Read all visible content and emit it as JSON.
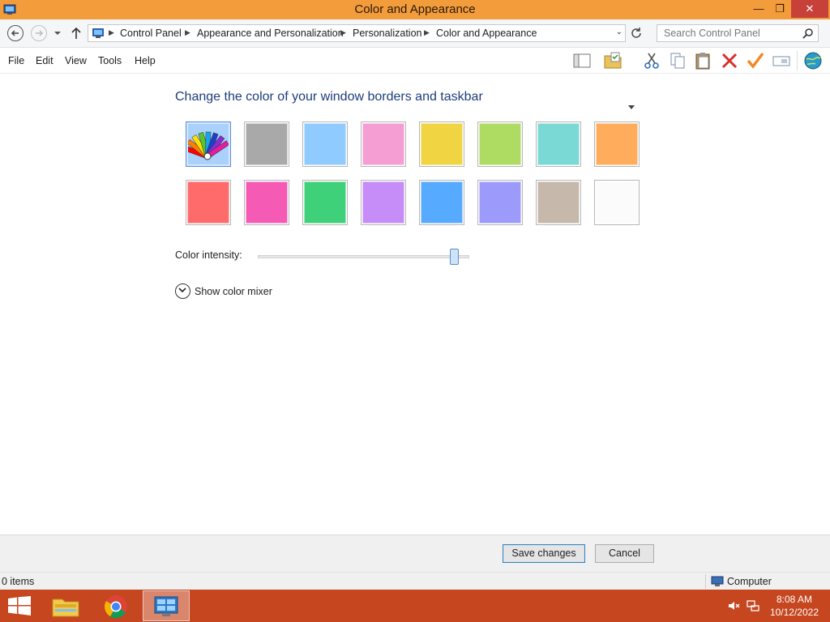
{
  "window": {
    "title": "Color and Appearance",
    "controls": {
      "minimize": "—",
      "restore": "❐",
      "close": "✕"
    }
  },
  "address": {
    "breadcrumbs": [
      "Control Panel",
      "Appearance and Personalization",
      "Personalization",
      "Color and Appearance"
    ],
    "search_placeholder": "Search Control Panel"
  },
  "menu": [
    "File",
    "Edit",
    "View",
    "Tools",
    "Help"
  ],
  "toolbar_icons": [
    "layout-pane-icon",
    "properties-folder-icon",
    "cut-icon",
    "copy-icon",
    "paste-icon",
    "delete-icon",
    "check-icon",
    "rename-icon",
    "globe-icon"
  ],
  "content": {
    "heading": "Change the color of your window borders and taskbar",
    "swatches": [
      {
        "name": "automatic",
        "color": "#8ec5f7",
        "selected": true
      },
      {
        "name": "gray",
        "color": "#a9a9a9"
      },
      {
        "name": "sky-blue",
        "color": "#8fcbff"
      },
      {
        "name": "pink",
        "color": "#f49ed4"
      },
      {
        "name": "yellow",
        "color": "#f1d442"
      },
      {
        "name": "lime",
        "color": "#aedb62"
      },
      {
        "name": "teal",
        "color": "#7ad8d5"
      },
      {
        "name": "orange",
        "color": "#ffad5c"
      },
      {
        "name": "red",
        "color": "#ff6b6b"
      },
      {
        "name": "magenta",
        "color": "#f55bb5"
      },
      {
        "name": "green",
        "color": "#3fd07a"
      },
      {
        "name": "lavender",
        "color": "#c68cf7"
      },
      {
        "name": "blue",
        "color": "#56aaff"
      },
      {
        "name": "periwinkle",
        "color": "#9c9bfc"
      },
      {
        "name": "taupe",
        "color": "#c6b8ab"
      },
      {
        "name": "white",
        "color": "#fbfbfb"
      }
    ],
    "intensity_label": "Color intensity:",
    "intensity_value": 0.93,
    "mixer_label": "Show color mixer"
  },
  "footer": {
    "save_label": "Save changes",
    "cancel_label": "Cancel"
  },
  "status": {
    "items": "0 items",
    "location": "Computer"
  },
  "taskbar": {
    "apps": [
      "start-button",
      "file-explorer",
      "chrome",
      "control-panel"
    ],
    "time": "8:08 AM",
    "date": "10/12/2022"
  },
  "colors": {
    "titlebar": "#f39c3c",
    "taskbar": "#c5461f",
    "heading": "#1e3d7b"
  }
}
